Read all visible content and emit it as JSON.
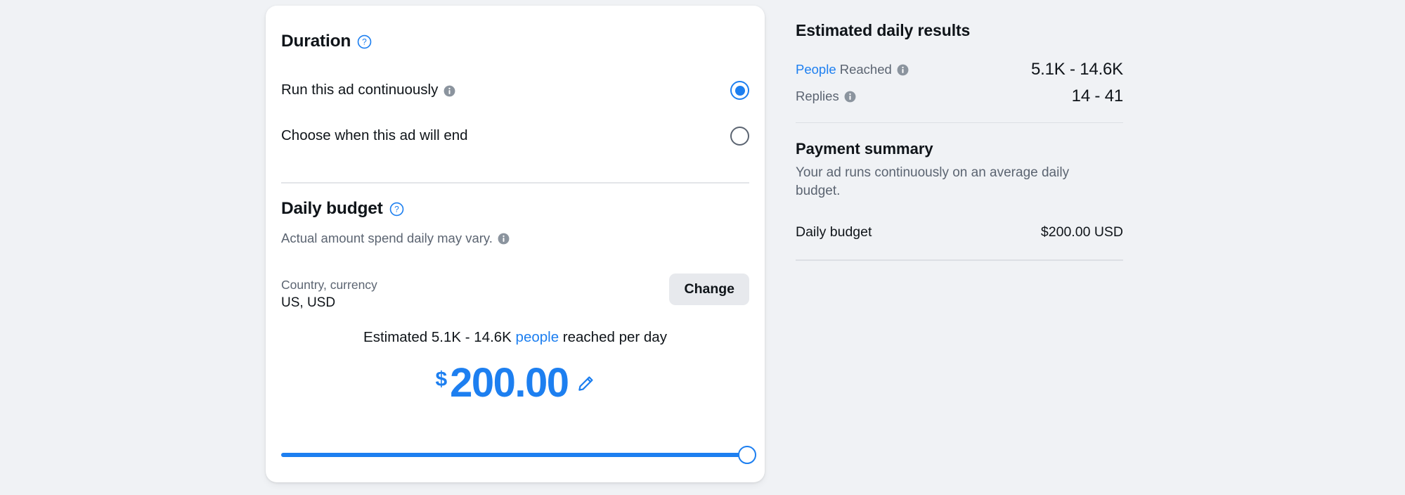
{
  "card": {
    "duration": {
      "title": "Duration",
      "help_icon": "question-circle-icon",
      "options": [
        {
          "label": "Run this ad continuously",
          "info_icon": "info-icon",
          "selected": true
        },
        {
          "label": "Choose when this ad will end",
          "info_icon": "",
          "selected": false
        }
      ]
    },
    "budget": {
      "title": "Daily budget",
      "help_icon": "question-circle-icon",
      "note": "Actual amount spend daily may vary.",
      "note_info_icon": "info-icon",
      "country_label": "Country, currency",
      "country_value": "US, USD",
      "change_label": "Change",
      "estimate_prefix": "Estimated 5.1K - 14.6K ",
      "estimate_link": "people",
      "estimate_suffix": " reached per day",
      "amount_currency": "$",
      "amount_value": "200.00",
      "edit_icon": "pencil-icon",
      "slider": {
        "name": "daily-budget-slider",
        "fill_percent": 98
      }
    }
  },
  "right_panel": {
    "title": "Estimated daily results",
    "results": [
      {
        "label_highlight": "People",
        "label_rest": " Reached",
        "info_icon": "info-icon",
        "value": "5.1K - 14.6K"
      },
      {
        "label_highlight": "",
        "label_rest": "Replies",
        "info_icon": "info-icon",
        "value": "14 - 41"
      }
    ],
    "payment": {
      "title": "Payment summary",
      "description": "Your ad runs continuously on an average daily budget.",
      "row_label": "Daily budget",
      "row_value": "$200.00 USD"
    }
  },
  "colors": {
    "accent_blue": "#1d7ff0",
    "text_primary": "#0f1419",
    "text_secondary": "#5b6471",
    "page_bg": "#f0f2f5",
    "card_bg": "#ffffff",
    "button_bg": "#e7e9ed"
  }
}
